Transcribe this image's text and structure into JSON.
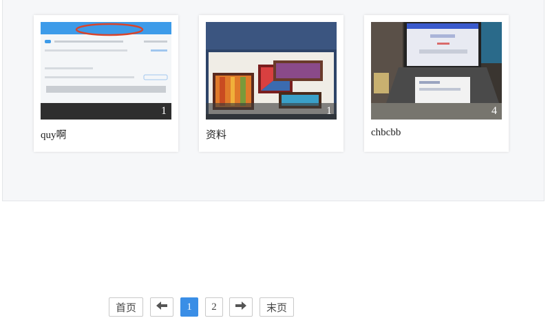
{
  "albums": [
    {
      "title": "quy啊",
      "count": "1",
      "thumbnail": "phone-screenshot-circled"
    },
    {
      "title": "资料",
      "count": "1",
      "thumbnail": "framed-paintings-photo"
    },
    {
      "title": "chbcbb",
      "count": "4",
      "thumbnail": "laptop-photo"
    }
  ],
  "pagination": {
    "first_label": "首页",
    "prev_icon": "arrow-left-icon",
    "pages": [
      "1",
      "2"
    ],
    "current_page": "1",
    "next_icon": "arrow-right-icon",
    "last_label": "末页"
  },
  "colors": {
    "accent": "#3a8ee6",
    "panel_background": "#f6f7f9"
  }
}
